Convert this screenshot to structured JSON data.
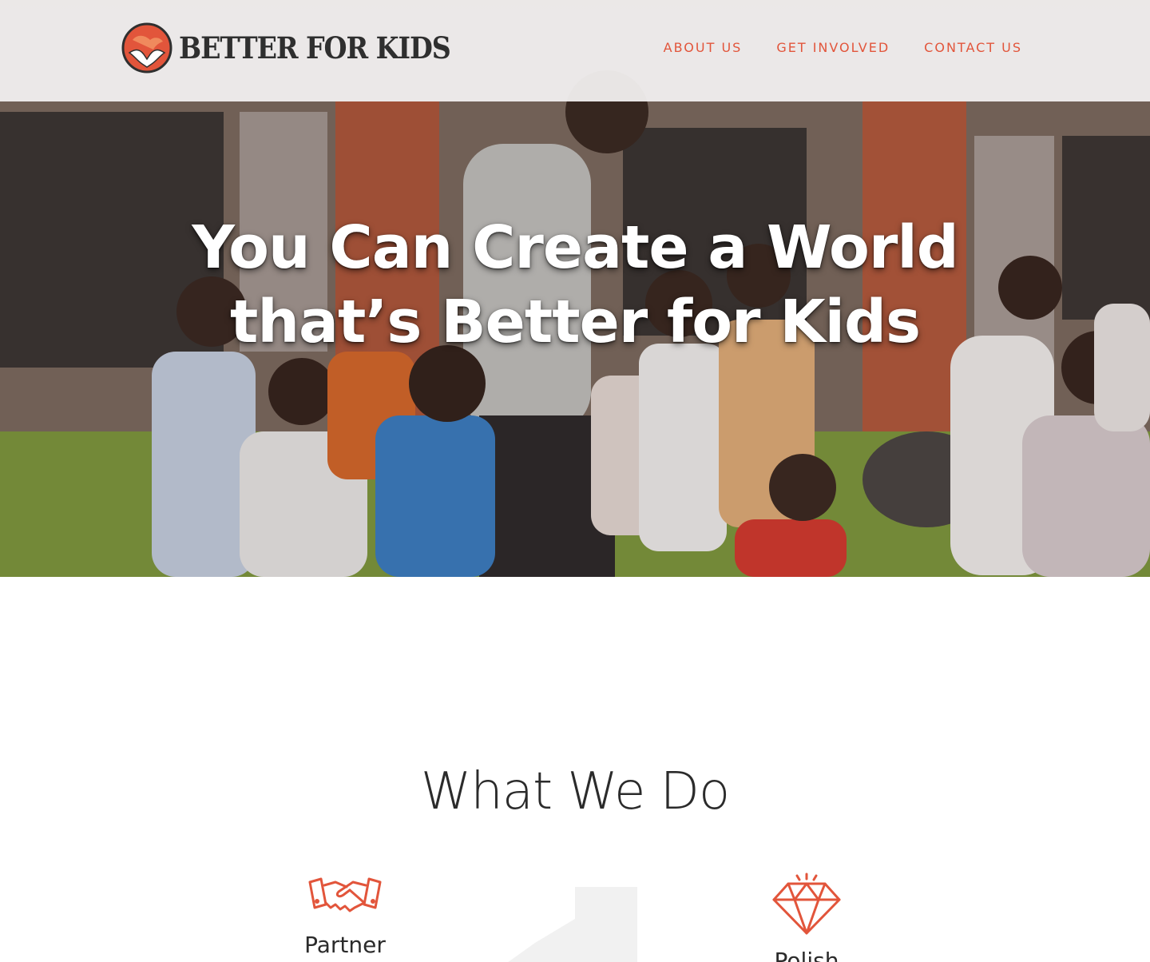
{
  "brand": {
    "name": "BETTER FOR KIDS",
    "accent_color": "#e2553b",
    "logo_icon": "hands-globe-icon"
  },
  "nav": {
    "items": [
      {
        "label": "ABOUT US"
      },
      {
        "label": "GET INVOLVED"
      },
      {
        "label": "CONTACT US"
      }
    ]
  },
  "hero": {
    "headline_line1": "You Can Create a World",
    "headline_line2": "that’s Better for Kids",
    "image": "children-with-adult-outside-school-photo"
  },
  "what_we_do": {
    "title": "What We Do",
    "features": [
      {
        "icon": "handshake-icon",
        "label": "Partner"
      },
      {
        "icon": "diamond-icon",
        "label": "Polish"
      }
    ]
  }
}
